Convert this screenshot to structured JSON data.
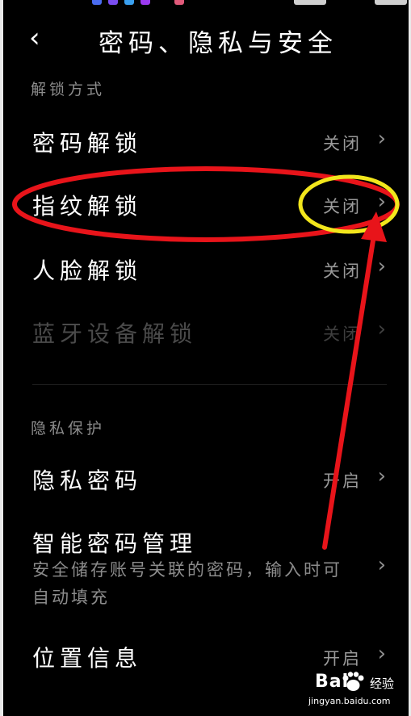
{
  "colors": {
    "background": "#000000",
    "label": "#ffffff",
    "secondary": "#9a9a9a",
    "annotation_red": "#e8141a",
    "annotation_yellow": "#f2e61c"
  },
  "header": {
    "back_icon": "chevron-left-icon",
    "title": "密码、隐私与安全"
  },
  "sections": {
    "unlock": {
      "title": "解锁方式",
      "items": [
        {
          "label": "密码解锁",
          "value": "关闭"
        },
        {
          "label": "指纹解锁",
          "value": "关闭"
        },
        {
          "label": "人脸解锁",
          "value": "关闭"
        },
        {
          "label": "蓝牙设备解锁",
          "value": "关闭",
          "disabled": true
        }
      ]
    },
    "privacy": {
      "title": "隐私保护",
      "items": [
        {
          "label": "隐私密码",
          "value": "开启"
        },
        {
          "label": "智能密码管理",
          "subtitle_line1": "安全储存账号关联的密码，输入时可",
          "subtitle_line2": "自动填充"
        },
        {
          "label": "位置信息",
          "value": "开启"
        }
      ]
    }
  },
  "watermark": {
    "brand": "Bai",
    "cn": "经验",
    "url": "jingyan.baidu.com"
  }
}
